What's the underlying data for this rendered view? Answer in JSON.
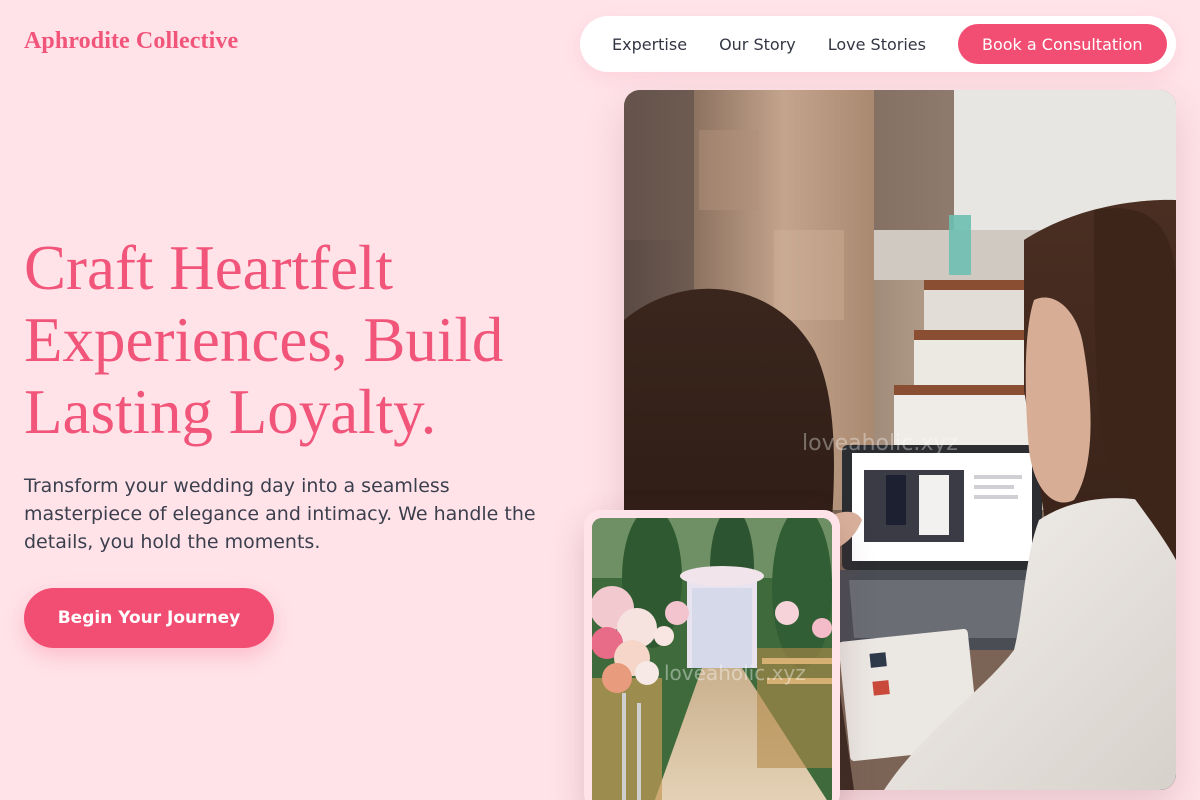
{
  "header": {
    "brand": "Aphrodite Collective",
    "nav": {
      "items": [
        {
          "label": "Expertise"
        },
        {
          "label": "Our Story"
        },
        {
          "label": "Love Stories"
        }
      ],
      "cta_label": "Book a Consultation"
    }
  },
  "hero": {
    "title": "Craft Heartfelt Experiences, Build Lasting Loyalty.",
    "subtitle": "Transform your wedding day into a seamless masterpiece of elegance and intimacy. We handle the details, you hold the moments.",
    "button_label": "Begin Your Journey"
  },
  "images": {
    "main_watermark": "loveaholic.xyz",
    "inset_watermark": "loveaholic.xyz"
  },
  "colors": {
    "background": "#ffe3e9",
    "accent": "#f24e73",
    "brand_text": "#f2557a",
    "body_text": "#3b3f4d",
    "nav_bg": "#ffffff"
  }
}
